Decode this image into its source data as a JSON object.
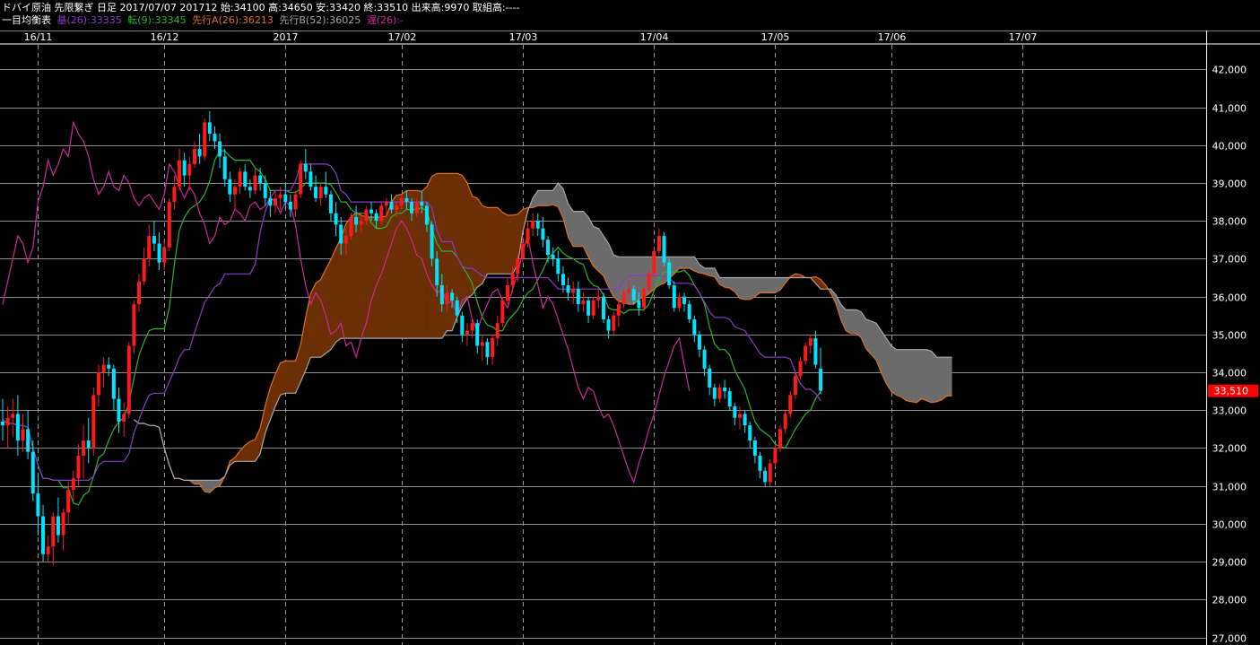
{
  "header": {
    "info": "ドバイ原油 先限繋ぎ 日足 2017/07/07 201712 始:34100 高:34650 安:33420 終:33510 出来高:9970 取組高:----",
    "indicator_name": "一目均衡表",
    "legend": [
      {
        "text": "基(26):33335",
        "color": "#8a3cc8"
      },
      {
        "text": "転(9):33345",
        "color": "#2db52d"
      },
      {
        "text": "先行A(26):36213",
        "color": "#e07020"
      },
      {
        "text": "先行B(52):36025",
        "color": "#a8a8a8"
      },
      {
        "text": "遅(26):-",
        "color": "#cc2a9a"
      }
    ]
  },
  "chart_data": {
    "type": "candlestick",
    "title": "ドバイ原油 先限繋ぎ 日足",
    "last_price_label": "33,510",
    "ylim": [
      26800,
      42600
    ],
    "y_ticks": [
      27000,
      28000,
      29000,
      30000,
      31000,
      32000,
      33000,
      34000,
      35000,
      36000,
      37000,
      38000,
      39000,
      40000,
      41000,
      42000
    ],
    "y_tick_labels": [
      "27,000",
      "28,000",
      "29,000",
      "30,000",
      "31,000",
      "32,000",
      "33,000",
      "34,000",
      "35,000",
      "36,000",
      "37,000",
      "38,000",
      "39,000",
      "40,000",
      "41,000",
      "42,000"
    ],
    "x_labels": [
      "16/11",
      "16/12",
      "2017",
      "17/02",
      "17/03",
      "17/04",
      "17/05",
      "17/06",
      "17/07"
    ],
    "x_label_index": [
      7,
      32,
      56,
      79,
      103,
      129,
      153,
      176,
      202
    ],
    "bars_total": 245,
    "candle_colors": {
      "up": "#ff1a1a",
      "down": "#00e5ff"
    },
    "ohlc": [
      [
        32700,
        33300,
        32200,
        32600
      ],
      [
        32600,
        33100,
        32000,
        32800
      ],
      [
        32800,
        33300,
        32300,
        32900
      ],
      [
        32900,
        33400,
        31800,
        32200
      ],
      [
        32200,
        32900,
        31900,
        32500
      ],
      [
        32500,
        33000,
        31700,
        31900
      ],
      [
        31900,
        32200,
        30600,
        30800
      ],
      [
        30800,
        31300,
        29700,
        30200
      ],
      [
        30200,
        30500,
        29000,
        29200
      ],
      [
        29200,
        29700,
        29000,
        29400
      ],
      [
        29400,
        30300,
        28900,
        30200
      ],
      [
        30200,
        30700,
        29500,
        29700
      ],
      [
        29700,
        30400,
        29300,
        30300
      ],
      [
        30300,
        31100,
        30000,
        30900
      ],
      [
        30900,
        31400,
        30600,
        31200
      ],
      [
        31200,
        32100,
        31000,
        31800
      ],
      [
        31800,
        32600,
        31200,
        32200
      ],
      [
        32200,
        32800,
        31600,
        32000
      ],
      [
        32000,
        33600,
        31800,
        33400
      ],
      [
        33400,
        34200,
        33100,
        34000
      ],
      [
        34000,
        34400,
        33600,
        34200
      ],
      [
        34200,
        34400,
        33900,
        34100
      ],
      [
        34100,
        34200,
        33000,
        33300
      ],
      [
        33300,
        33600,
        32400,
        32700
      ],
      [
        32700,
        33200,
        32300,
        32900
      ],
      [
        32900,
        34800,
        32800,
        34700
      ],
      [
        34700,
        35900,
        34500,
        35800
      ],
      [
        35800,
        36600,
        35600,
        36400
      ],
      [
        36400,
        37300,
        36300,
        37000
      ],
      [
        37000,
        37900,
        36800,
        37600
      ],
      [
        37600,
        38000,
        37200,
        37400
      ],
      [
        37400,
        37700,
        36700,
        36900
      ],
      [
        36900,
        37500,
        36700,
        37300
      ],
      [
        37300,
        38600,
        37200,
        38500
      ],
      [
        38500,
        39200,
        38300,
        38900
      ],
      [
        38900,
        39900,
        38800,
        39600
      ],
      [
        39600,
        39800,
        38900,
        39200
      ],
      [
        39200,
        39700,
        38800,
        39500
      ],
      [
        39500,
        40100,
        39400,
        39900
      ],
      [
        39900,
        40300,
        39500,
        39700
      ],
      [
        39700,
        40700,
        39600,
        40600
      ],
      [
        40600,
        40900,
        40100,
        40300
      ],
      [
        40300,
        40500,
        39900,
        40100
      ],
      [
        40100,
        40300,
        39400,
        39700
      ],
      [
        39700,
        39900,
        38900,
        39100
      ],
      [
        39100,
        39300,
        38500,
        38700
      ],
      [
        38700,
        39100,
        38300,
        38900
      ],
      [
        38900,
        39400,
        38700,
        39300
      ],
      [
        39300,
        39500,
        38800,
        38900
      ],
      [
        38900,
        39100,
        38600,
        38800
      ],
      [
        38800,
        39400,
        38700,
        39200
      ],
      [
        39200,
        39400,
        38800,
        39000
      ],
      [
        39000,
        39200,
        38400,
        38600
      ],
      [
        38600,
        38800,
        38100,
        38400
      ],
      [
        38400,
        38800,
        38200,
        38600
      ],
      [
        38600,
        38900,
        38300,
        38700
      ],
      [
        38700,
        39000,
        38300,
        38500
      ],
      [
        38500,
        38700,
        38100,
        38300
      ],
      [
        38300,
        38800,
        38100,
        38700
      ],
      [
        38700,
        39600,
        38600,
        39500
      ],
      [
        39500,
        39900,
        39100,
        39300
      ],
      [
        39300,
        39500,
        38800,
        38900
      ],
      [
        38900,
        39200,
        38500,
        38600
      ],
      [
        38600,
        39000,
        38400,
        38900
      ],
      [
        38900,
        39300,
        38600,
        38700
      ],
      [
        38700,
        38800,
        38000,
        38200
      ],
      [
        38200,
        38500,
        37600,
        37900
      ],
      [
        37900,
        38100,
        37100,
        37400
      ],
      [
        37400,
        37800,
        37100,
        37600
      ],
      [
        37600,
        38200,
        37500,
        38100
      ],
      [
        38100,
        38400,
        37700,
        37900
      ],
      [
        37900,
        38200,
        37700,
        38000
      ],
      [
        38000,
        38400,
        37900,
        38300
      ],
      [
        38300,
        38500,
        38000,
        38200
      ],
      [
        38200,
        38300,
        37800,
        38000
      ],
      [
        38000,
        38500,
        37900,
        38400
      ],
      [
        38400,
        38600,
        38100,
        38500
      ],
      [
        38500,
        38700,
        38200,
        38300
      ],
      [
        38300,
        38500,
        38100,
        38400
      ],
      [
        38400,
        38700,
        38300,
        38600
      ],
      [
        38600,
        38800,
        38300,
        38500
      ],
      [
        38500,
        38600,
        38000,
        38200
      ],
      [
        38200,
        38600,
        38100,
        38500
      ],
      [
        38500,
        38800,
        38200,
        38400
      ],
      [
        38400,
        38500,
        37700,
        37900
      ],
      [
        37900,
        38000,
        36800,
        37000
      ],
      [
        37000,
        37200,
        36000,
        36300
      ],
      [
        36300,
        36600,
        35600,
        35800
      ],
      [
        35800,
        36300,
        35600,
        36100
      ],
      [
        36100,
        36200,
        35700,
        35900
      ],
      [
        35900,
        36000,
        35300,
        35500
      ],
      [
        35500,
        35600,
        34800,
        35000
      ],
      [
        35000,
        35300,
        34700,
        35100
      ],
      [
        35100,
        35400,
        34900,
        35300
      ],
      [
        35300,
        35400,
        34500,
        34700
      ],
      [
        34700,
        35000,
        34300,
        34800
      ],
      [
        34800,
        34900,
        34200,
        34400
      ],
      [
        34400,
        35000,
        34200,
        34900
      ],
      [
        34900,
        35500,
        34700,
        35300
      ],
      [
        35300,
        36000,
        35200,
        35900
      ],
      [
        35900,
        36500,
        35800,
        36300
      ],
      [
        36300,
        36800,
        36100,
        36600
      ],
      [
        36600,
        37100,
        36400,
        37000
      ],
      [
        37000,
        37600,
        36900,
        37400
      ],
      [
        37400,
        38000,
        37300,
        37800
      ],
      [
        37800,
        38200,
        37600,
        38000
      ],
      [
        38000,
        38200,
        37600,
        37800
      ],
      [
        37800,
        38100,
        37300,
        37500
      ],
      [
        37500,
        37600,
        36900,
        37100
      ],
      [
        37100,
        37300,
        36800,
        37000
      ],
      [
        37000,
        37200,
        36400,
        36600
      ],
      [
        36600,
        36800,
        36100,
        36300
      ],
      [
        36300,
        36500,
        35900,
        36100
      ],
      [
        36100,
        36400,
        35800,
        36200
      ],
      [
        36200,
        36400,
        35600,
        35800
      ],
      [
        35800,
        36100,
        35600,
        35900
      ],
      [
        35900,
        36000,
        35300,
        35500
      ],
      [
        35500,
        36000,
        35400,
        35900
      ],
      [
        35900,
        36200,
        35700,
        36000
      ],
      [
        36000,
        36100,
        35300,
        35400
      ],
      [
        35400,
        35500,
        34900,
        35100
      ],
      [
        35100,
        35600,
        35000,
        35500
      ],
      [
        35500,
        35900,
        35200,
        35800
      ],
      [
        35800,
        36200,
        35700,
        36100
      ],
      [
        36100,
        36400,
        35900,
        36200
      ],
      [
        36200,
        36300,
        35800,
        35900
      ],
      [
        35900,
        36100,
        35500,
        35700
      ],
      [
        35700,
        36300,
        35600,
        36200
      ],
      [
        36200,
        36700,
        36100,
        36600
      ],
      [
        36600,
        37300,
        36500,
        37200
      ],
      [
        37200,
        37800,
        37100,
        37600
      ],
      [
        37600,
        37700,
        36800,
        36900
      ],
      [
        36900,
        37000,
        36200,
        36300
      ],
      [
        36300,
        36400,
        35600,
        35700
      ],
      [
        35700,
        36100,
        35600,
        36000
      ],
      [
        36000,
        36100,
        35600,
        35800
      ],
      [
        35800,
        35900,
        35300,
        35400
      ],
      [
        35400,
        35500,
        34800,
        35000
      ],
      [
        35000,
        35100,
        34400,
        34600
      ],
      [
        34600,
        34700,
        33900,
        34100
      ],
      [
        34100,
        34200,
        33400,
        33600
      ],
      [
        33600,
        33700,
        33100,
        33300
      ],
      [
        33300,
        33700,
        33200,
        33600
      ],
      [
        33600,
        33800,
        33300,
        33500
      ],
      [
        33500,
        33600,
        33000,
        33100
      ],
      [
        33100,
        33200,
        32600,
        32800
      ],
      [
        32800,
        33100,
        32500,
        32900
      ],
      [
        32900,
        33000,
        32400,
        32600
      ],
      [
        32600,
        32700,
        32000,
        32200
      ],
      [
        32200,
        32300,
        31600,
        31800
      ],
      [
        31800,
        31900,
        31200,
        31400
      ],
      [
        31400,
        31500,
        31000,
        31100
      ],
      [
        31100,
        31700,
        31000,
        31600
      ],
      [
        31600,
        32100,
        31500,
        32000
      ],
      [
        32000,
        32600,
        31900,
        32500
      ],
      [
        32500,
        33000,
        32400,
        32900
      ],
      [
        32900,
        33500,
        32800,
        33400
      ],
      [
        33400,
        34000,
        33300,
        33900
      ],
      [
        33900,
        34400,
        33800,
        34300
      ],
      [
        34300,
        34800,
        34200,
        34700
      ],
      [
        34700,
        35000,
        34500,
        34900
      ],
      [
        34900,
        35100,
        34100,
        34200
      ],
      [
        34100,
        34650,
        33420,
        33510
      ]
    ],
    "ichimoku": {
      "conversion_line": {
        "name": "転(9)",
        "color": "#2db52d",
        "last": 33345
      },
      "base_line": {
        "name": "基(26)",
        "color": "#8a3cc8",
        "last": 33335
      },
      "leading_span_a": {
        "name": "先行A(26)",
        "color": "#e07020",
        "last": 36213
      },
      "leading_span_b": {
        "name": "先行B(52)",
        "color": "#a8a8a8",
        "last": 36025
      },
      "lagging_span": {
        "name": "遅(26)",
        "color": "#cc2a9a"
      },
      "cloud_colors": {
        "bullish": "#6b2e05",
        "bearish": "#6b6b6b"
      }
    }
  }
}
